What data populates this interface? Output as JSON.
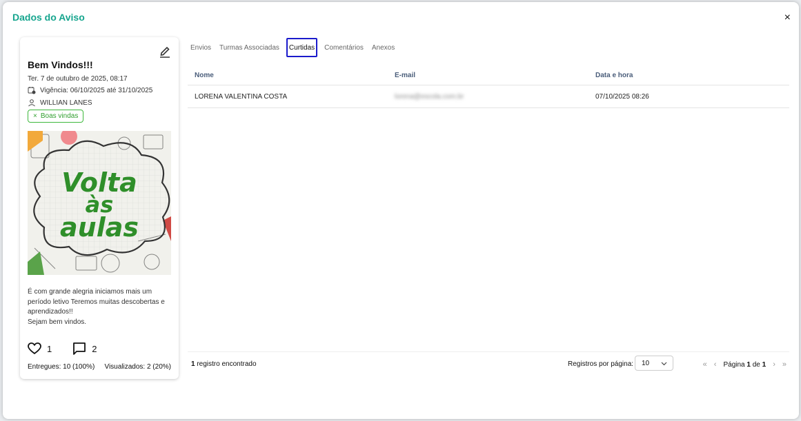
{
  "modal": {
    "title": "Dados do Aviso",
    "close_label": "×"
  },
  "card": {
    "title": "Bem Vindos!!!",
    "date": "Ter. 7 de outubro de 2025, 08:17",
    "validity": "Vigência: 06/10/2025 até 31/10/2025",
    "author": "WILLIAN LANES",
    "tag": "Boas vindas",
    "image_text": {
      "line1": "Volta",
      "line2": "às",
      "line3": "aulas"
    },
    "description": {
      "line1": "É com grande alegria iniciamos mais um período letivo Teremos muitas descobertas e aprendizados!!",
      "line2": "Sejam bem vindos."
    },
    "likes": "1",
    "comments": "2",
    "delivered": "Entregues: 10 (100%)",
    "viewed": "Visualizados: 2 (20%)"
  },
  "tabs": [
    {
      "label": "Envios"
    },
    {
      "label": "Turmas Associadas"
    },
    {
      "label": "Curtidas"
    },
    {
      "label": "Comentários"
    },
    {
      "label": "Anexos"
    }
  ],
  "table": {
    "headers": [
      "Nome",
      "E-mail",
      "Data e hora"
    ],
    "rows": [
      {
        "name": "LORENA VALENTINA COSTA",
        "email": "lorena@escola.com.br",
        "datetime": "07/10/2025 08:26"
      }
    ]
  },
  "footer": {
    "count_number": "1",
    "count_text": " registro encontrado",
    "per_page_label": "Registros por página:",
    "per_page_value": "10",
    "page_prefix": "Página ",
    "page_current": "1",
    "page_sep": " de ",
    "page_total": "1"
  },
  "colors": {
    "accent": "#16a58e",
    "tag_green": "#3cb83a",
    "active_tab_border": "#1a1acc",
    "poster_green": "#2f8f2a"
  }
}
